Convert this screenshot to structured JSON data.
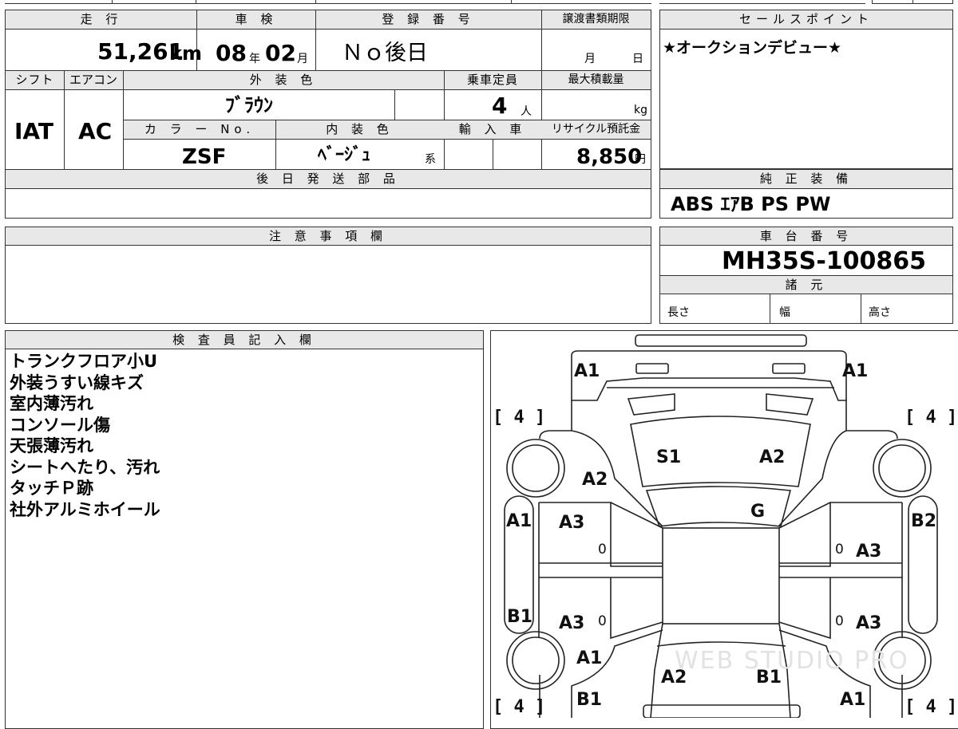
{
  "vehicle": {
    "mileage_header": "走 行",
    "mileage_value": "51,261",
    "mileage_unit": "km",
    "inspection_header": "車 検",
    "inspection_year": "08",
    "inspection_year_unit": "年",
    "inspection_month": "02",
    "inspection_month_unit": "月",
    "registration_header": "登 録 番 号",
    "registration_value": "Ｎｏ後日",
    "transfer_deadline_header": "譲渡書類期限",
    "transfer_month_unit": "月",
    "transfer_day_unit": "日",
    "shift_header": "シフト",
    "shift_value": "IAT",
    "ac_header": "エアコン",
    "ac_value": "AC",
    "exterior_color_header": "外 装 色",
    "exterior_color_value": "ﾌﾞﾗｳﾝ",
    "capacity_header": "乗車定員",
    "capacity_value": "4",
    "capacity_unit": "人",
    "max_load_header": "最大積載量",
    "max_load_unit": "kg",
    "color_no_header": "カ ラ ー No.",
    "color_no_value": "ZSF",
    "interior_color_header": "内 装 色",
    "interior_color_value": "ﾍﾞｰｼﾞｭ",
    "interior_color_suffix": "系",
    "import_header": "輸 入 車",
    "recycle_fee_header": "リサイクル預託金",
    "recycle_fee_value": "8,850",
    "recycle_fee_unit": "円",
    "later_parts_header": "後 日 発 送 部 品",
    "caution_header": "注 意 事 項 欄"
  },
  "sales_point": {
    "header": "セールスポイント",
    "text": "★オークションデビュー★"
  },
  "equipment": {
    "header": "純 正 装 備",
    "value": "ABS ｴｱB PS PW"
  },
  "chassis": {
    "header": "車 台 番 号",
    "value": "MH35S-100865"
  },
  "specs": {
    "header": "諸 元",
    "length_label": "長さ",
    "width_label": "幅",
    "height_label": "高さ"
  },
  "inspector": {
    "header": "検 査 員 記 入 欄",
    "notes": [
      "トランクフロア小U",
      "外装うすい線キズ",
      "室内薄汚れ",
      "コンソール傷",
      "天張薄汚れ",
      "シートへたり、汚れ",
      "タッチＰ跡",
      "社外アルミホイール"
    ]
  },
  "diagram": {
    "watermark": "WEB STUDIO PRO",
    "tire_labels": [
      "[ 4 ]",
      "[ 4 ]",
      "[ 4 ]",
      "[ 4 ]"
    ],
    "marks": {
      "front_left": "A1",
      "front_right": "A1",
      "hood_left": "S1",
      "hood_right": "A2",
      "left_fender": "A2",
      "windshield": "G",
      "left_pillar": "A1",
      "left_front_door": "A3",
      "left_front_door_depth": "0",
      "right_side": "B2",
      "right_front_door_depth": "0",
      "right_front_door": "A3",
      "left_rocker": "B1",
      "left_rear_door": "A3",
      "left_rear_door_depth": "0",
      "right_rear_door_depth": "0",
      "right_rear_door": "A3",
      "left_rear_fender": "A1",
      "trunk_left": "A2",
      "trunk_right": "B1",
      "rear_left": "B1",
      "rear_right": "A1"
    }
  }
}
